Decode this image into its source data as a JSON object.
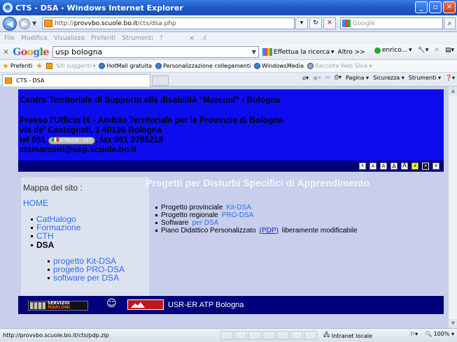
{
  "window": {
    "title": "CTS - DSA - Windows Internet Explorer"
  },
  "address": {
    "url_prefix": "http://",
    "url_host": "provvbo.scuole.bo.it",
    "url_path": "/cts/dsa.php",
    "search_placeholder": "Google"
  },
  "menubar": [
    "File",
    "Modifica",
    "Visualizza",
    "Preferiti",
    "Strumenti",
    "?"
  ],
  "google_toolbar": {
    "query": "usp bologna",
    "search_btn": "Effettua la ricerca",
    "more": "Altro >>",
    "user": "enrico..."
  },
  "favorites": {
    "label": "Preferiti",
    "items": [
      "Siti suggeriti",
      "HotMail gratuita",
      "Personalizzazione collegamenti",
      "WindowsMedia",
      "Raccolta Web Slice"
    ]
  },
  "tab": {
    "title": "CTS - DSA"
  },
  "commandbar": [
    "Pagina",
    "Sicurezza",
    "Strumenti"
  ],
  "header": {
    "line1": "Centro Territoriale di Supporto alla disabilità \"Marconi\" - Bologna",
    "line2": "Presso l'Ufficio IX - Ambito Territoriale per la Provincia di Bologna",
    "line3": "via de' Castagnoli, 1 40126 Bologna",
    "phone_prefix": "tel 051",
    "phone_badge": "3785215 - 217",
    "fax": ", fax 051 3785218",
    "email": "ctsmarconi@usp.scuole.bo.it"
  },
  "accessibility": [
    "A",
    "A",
    "A",
    "A",
    "A"
  ],
  "sidebar": {
    "title": "Mappa del sito :",
    "home": "HOME",
    "items": [
      "CatHalogo",
      "Formazione",
      "CTH",
      "DSA"
    ],
    "subitems": [
      "progetto Kit-DSA",
      "progetto PRO-DSA",
      "software per DSA"
    ]
  },
  "main": {
    "title": "Progetti per Disturbi Specifici di Apprendimento",
    "items": [
      {
        "prefix": "Progetto provinciale ",
        "link": "Kit-DSA",
        "suffix": ""
      },
      {
        "prefix": "Progetto regionale ",
        "link": "PRO-DSA",
        "suffix": ""
      },
      {
        "prefix": "Software ",
        "link": "per DSA",
        "suffix": ""
      },
      {
        "prefix": "Piano Didattico Personalizzato ",
        "link": "(PDP)",
        "suffix": " liberamente modificabile"
      }
    ]
  },
  "footer": {
    "servizi_top": "SERVIZIO",
    "servizi_bottom": "MARCONI",
    "usr_text": "USR-ER ATP Bologna"
  },
  "status": {
    "url": "http://provvbo.scuole.bo.it/cts/pdp.zip",
    "zone": "Intranet locale",
    "zoom": "100%"
  }
}
